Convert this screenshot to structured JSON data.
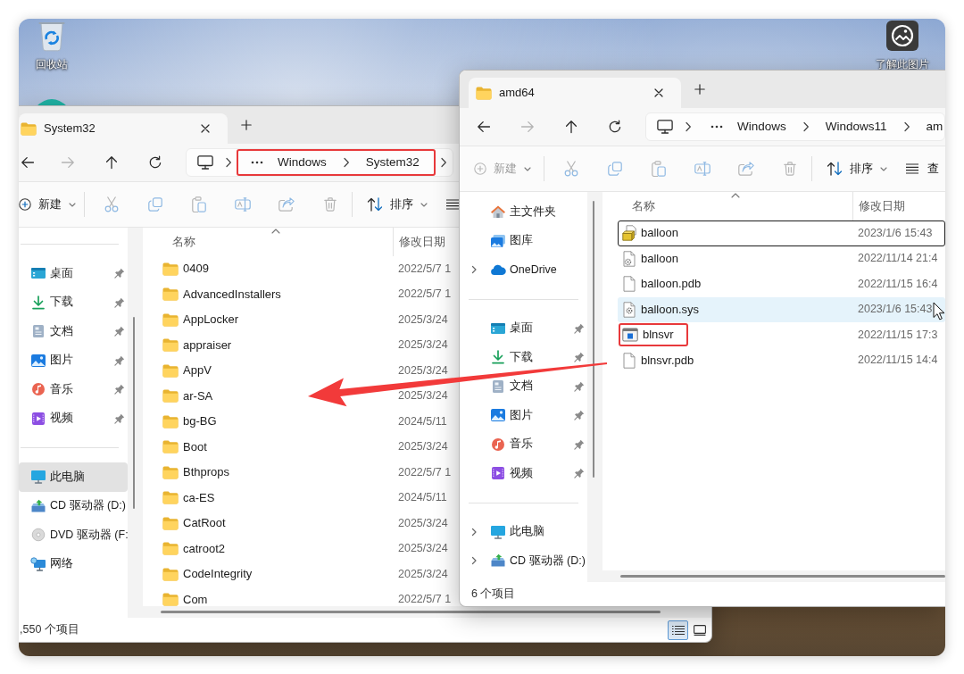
{
  "desktop": {
    "left_icons": [
      {
        "kind": "recycle_bin",
        "label": "回收站"
      },
      {
        "kind": "app"
      }
    ],
    "right_icons": [
      {
        "kind": "picture_info",
        "label": "了解此图片"
      }
    ]
  },
  "windows": [
    {
      "tab": {
        "title": "System32"
      },
      "address": {
        "segments": [
          "Windows",
          "System32"
        ],
        "highlighted": true,
        "cut_off": false
      },
      "toolbar": {
        "new_label": "新建",
        "new_disabled": false,
        "sort_label": "排序"
      },
      "sidebar": {
        "scrolled": true,
        "groups": [
          [
            {
              "kind": "desktop",
              "label": "桌面",
              "pinned": true,
              "expander": false,
              "selected": false
            },
            {
              "kind": "downloads",
              "label": "下载",
              "pinned": true,
              "expander": false,
              "selected": false
            },
            {
              "kind": "documents",
              "label": "文档",
              "pinned": true,
              "expander": false,
              "selected": false
            },
            {
              "kind": "pictures",
              "label": "图片",
              "pinned": true,
              "expander": false,
              "selected": false
            },
            {
              "kind": "music",
              "label": "音乐",
              "pinned": true,
              "expander": false,
              "selected": false
            },
            {
              "kind": "videos",
              "label": "视频",
              "pinned": true,
              "expander": false,
              "selected": false
            }
          ],
          [
            {
              "kind": "pc",
              "label": "此电脑",
              "pinned": false,
              "expander": false,
              "selected": true
            },
            {
              "kind": "cd",
              "label": "CD 驱动器 (D:)",
              "pinned": false,
              "expander": false,
              "selected": false
            },
            {
              "kind": "dvd",
              "label": "DVD 驱动器 (F:",
              "pinned": false,
              "expander": false,
              "selected": false
            },
            {
              "kind": "network",
              "label": "网络",
              "pinned": false,
              "expander": false,
              "selected": false
            }
          ]
        ]
      },
      "columns": [
        {
          "label": "名称",
          "sorted": true
        },
        {
          "label": "修改日期",
          "sorted": false
        }
      ],
      "files": [
        {
          "kind": "folder",
          "name": "0409",
          "modified": "2022/5/7 1"
        },
        {
          "kind": "folder",
          "name": "AdvancedInstallers",
          "modified": "2022/5/7 1"
        },
        {
          "kind": "folder",
          "name": "AppLocker",
          "modified": "2025/3/24"
        },
        {
          "kind": "folder",
          "name": "appraiser",
          "modified": "2025/3/24"
        },
        {
          "kind": "folder",
          "name": "AppV",
          "modified": "2025/3/24"
        },
        {
          "kind": "folder",
          "name": "ar-SA",
          "modified": "2025/3/24"
        },
        {
          "kind": "folder",
          "name": "bg-BG",
          "modified": "2024/5/11"
        },
        {
          "kind": "folder",
          "name": "Boot",
          "modified": "2025/3/24"
        },
        {
          "kind": "folder",
          "name": "Bthprops",
          "modified": "2022/5/7 1"
        },
        {
          "kind": "folder",
          "name": "ca-ES",
          "modified": "2024/5/11"
        },
        {
          "kind": "folder",
          "name": "CatRoot",
          "modified": "2025/3/24"
        },
        {
          "kind": "folder",
          "name": "catroot2",
          "modified": "2025/3/24"
        },
        {
          "kind": "folder",
          "name": "CodeIntegrity",
          "modified": "2025/3/24"
        },
        {
          "kind": "folder",
          "name": "Com",
          "modified": "2022/5/7 1"
        }
      ],
      "status": ",550 个项目",
      "view_buttons": [
        {
          "kind": "details",
          "selected": true
        },
        {
          "kind": "tiles",
          "selected": false
        }
      ]
    },
    {
      "tab": {
        "title": "amd64"
      },
      "address": {
        "segments": [
          "Windows",
          "Windows11",
          "am"
        ],
        "highlighted": false,
        "cut_off": true
      },
      "toolbar": {
        "new_label": "新建",
        "new_disabled": true,
        "sort_label": "排序",
        "view_label": "查"
      },
      "sidebar": {
        "scrolled": false,
        "groups": [
          [
            {
              "kind": "home",
              "label": "主文件夹",
              "pinned": false,
              "expander": false,
              "selected": false
            },
            {
              "kind": "gallery",
              "label": "图库",
              "pinned": false,
              "expander": false,
              "selected": false
            },
            {
              "kind": "onedrive",
              "label": "OneDrive",
              "pinned": false,
              "expander": true,
              "selected": false
            }
          ],
          [
            {
              "kind": "desktop",
              "label": "桌面",
              "pinned": true,
              "expander": false,
              "selected": false
            },
            {
              "kind": "downloads",
              "label": "下载",
              "pinned": true,
              "expander": false,
              "selected": false
            },
            {
              "kind": "documents",
              "label": "文档",
              "pinned": true,
              "expander": false,
              "selected": false
            },
            {
              "kind": "pictures",
              "label": "图片",
              "pinned": true,
              "expander": false,
              "selected": false
            },
            {
              "kind": "music",
              "label": "音乐",
              "pinned": true,
              "expander": false,
              "selected": false
            },
            {
              "kind": "videos",
              "label": "视频",
              "pinned": true,
              "expander": false,
              "selected": false
            }
          ],
          [
            {
              "kind": "pc",
              "label": "此电脑",
              "pinned": false,
              "expander": true,
              "selected": false
            },
            {
              "kind": "cd",
              "label": "CD 驱动器 (D:)",
              "pinned": false,
              "expander": true,
              "selected": false
            }
          ]
        ]
      },
      "columns": [
        {
          "label": "名称",
          "sorted": true
        },
        {
          "label": "修改日期",
          "sorted": false
        }
      ],
      "files": [
        {
          "kind": "installer",
          "name": "balloon",
          "modified": "2023/1/6 15:43",
          "focused": true,
          "hovered": false,
          "highlighted": false
        },
        {
          "kind": "config",
          "name": "balloon",
          "modified": "2022/11/14 21:4",
          "focused": false,
          "hovered": false,
          "highlighted": false
        },
        {
          "kind": "blank",
          "name": "balloon.pdb",
          "modified": "2022/11/15 16:4",
          "focused": false,
          "hovered": false,
          "highlighted": false
        },
        {
          "kind": "system",
          "name": "balloon.sys",
          "modified": "2023/1/6 15:43",
          "focused": false,
          "hovered": true,
          "highlighted": false
        },
        {
          "kind": "app",
          "name": "blnsvr",
          "modified": "2022/11/15 17:3",
          "focused": false,
          "hovered": false,
          "highlighted": true
        },
        {
          "kind": "blank",
          "name": "blnsvr.pdb",
          "modified": "2022/11/15 14:4",
          "focused": false,
          "hovered": false,
          "highlighted": false
        }
      ],
      "status": "6 个项目"
    }
  ],
  "annotation": {
    "arrow": true
  }
}
